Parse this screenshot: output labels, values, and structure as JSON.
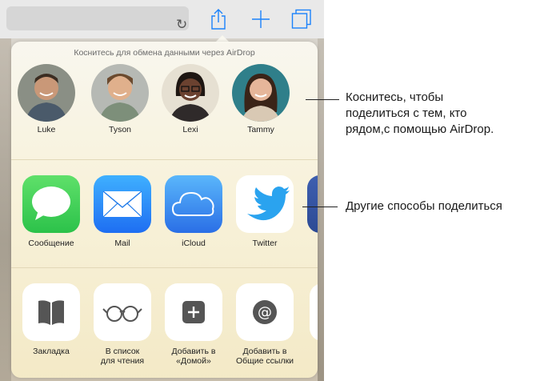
{
  "toolbar": {
    "reload_icon": "reload-icon",
    "share_icon": "share-icon",
    "add_icon": "plus-icon",
    "tabs_icon": "tabs-icon"
  },
  "sheet": {
    "airdrop_hint": "Коснитесь для обмена данными через AirDrop",
    "people": [
      {
        "name": "Luke"
      },
      {
        "name": "Tyson"
      },
      {
        "name": "Lexi"
      },
      {
        "name": "Tammy"
      }
    ],
    "apps": [
      {
        "label": "Сообщение",
        "icon": "messages-icon"
      },
      {
        "label": "Mail",
        "icon": "mail-icon"
      },
      {
        "label": "iCloud",
        "icon": "icloud-icon"
      },
      {
        "label": "Twitter",
        "icon": "twitter-icon"
      }
    ],
    "actions": [
      {
        "label": "Закладка",
        "icon": "book-icon"
      },
      {
        "label": "В список\nдля чтения",
        "icon": "glasses-icon"
      },
      {
        "label": "Добавить в\n«Домой»",
        "icon": "add-home-icon"
      },
      {
        "label": "Добавить в\nОбщие ссылки",
        "icon": "at-icon"
      }
    ]
  },
  "callouts": {
    "airdrop": "Коснитесь, чтобы\nподелиться с тем, кто\nрядом,с помощью AirDrop.",
    "other": "Другие способы поделиться"
  },
  "colors": {
    "accent": "#1a82fb",
    "messages": "#35c84f",
    "twitter": "#2aa3ef"
  }
}
